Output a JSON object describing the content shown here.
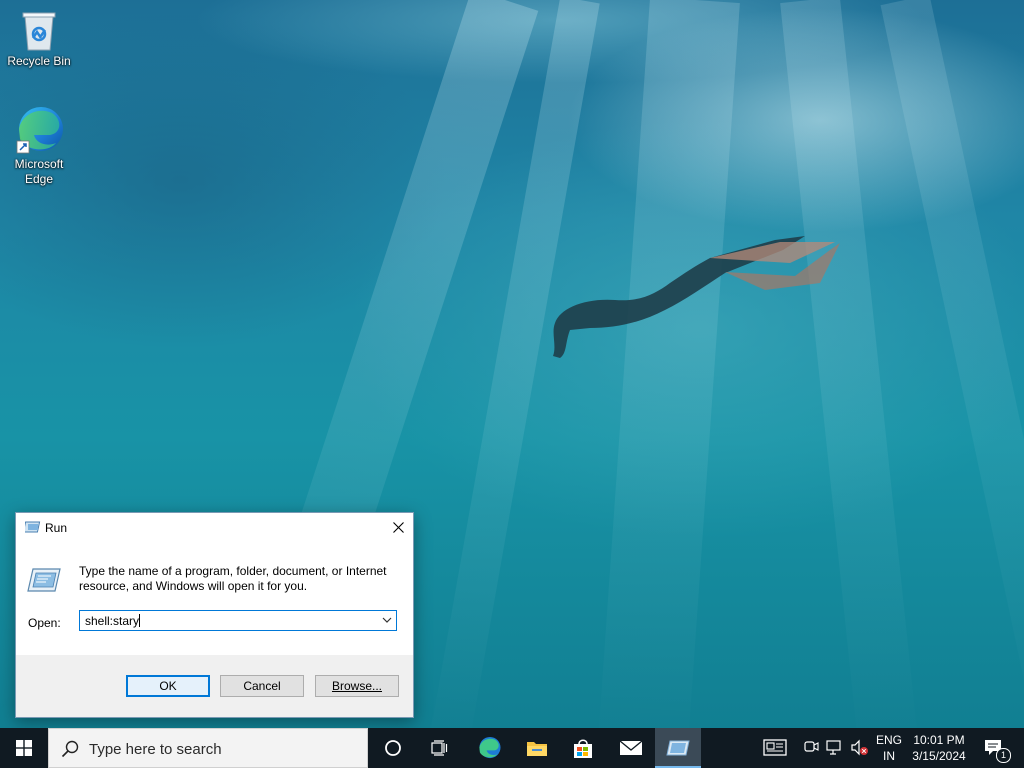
{
  "desktop": {
    "icons": [
      {
        "label": "Recycle Bin"
      },
      {
        "label": "Microsoft Edge"
      }
    ]
  },
  "run_dialog": {
    "title": "Run",
    "description": "Type the name of a program, folder, document, or Internet resource, and Windows will open it for you.",
    "open_label": "Open:",
    "open_value": "shell:stary",
    "ok_label": "OK",
    "cancel_label": "Cancel",
    "browse_label": "Browse..."
  },
  "taskbar": {
    "search_placeholder": "Type here to search",
    "pinned": [
      "task-view",
      "microsoft-edge",
      "file-explorer",
      "microsoft-store",
      "mail",
      "run"
    ],
    "active_app": "run",
    "tray": {
      "language_line1": "ENG",
      "language_line2": "IN",
      "time": "10:01 PM",
      "date": "3/15/2024",
      "notification_count": "1"
    }
  },
  "colors": {
    "accent": "#0078d7",
    "taskbar": "#101a22",
    "dialog_bg": "#f0f0f0"
  }
}
